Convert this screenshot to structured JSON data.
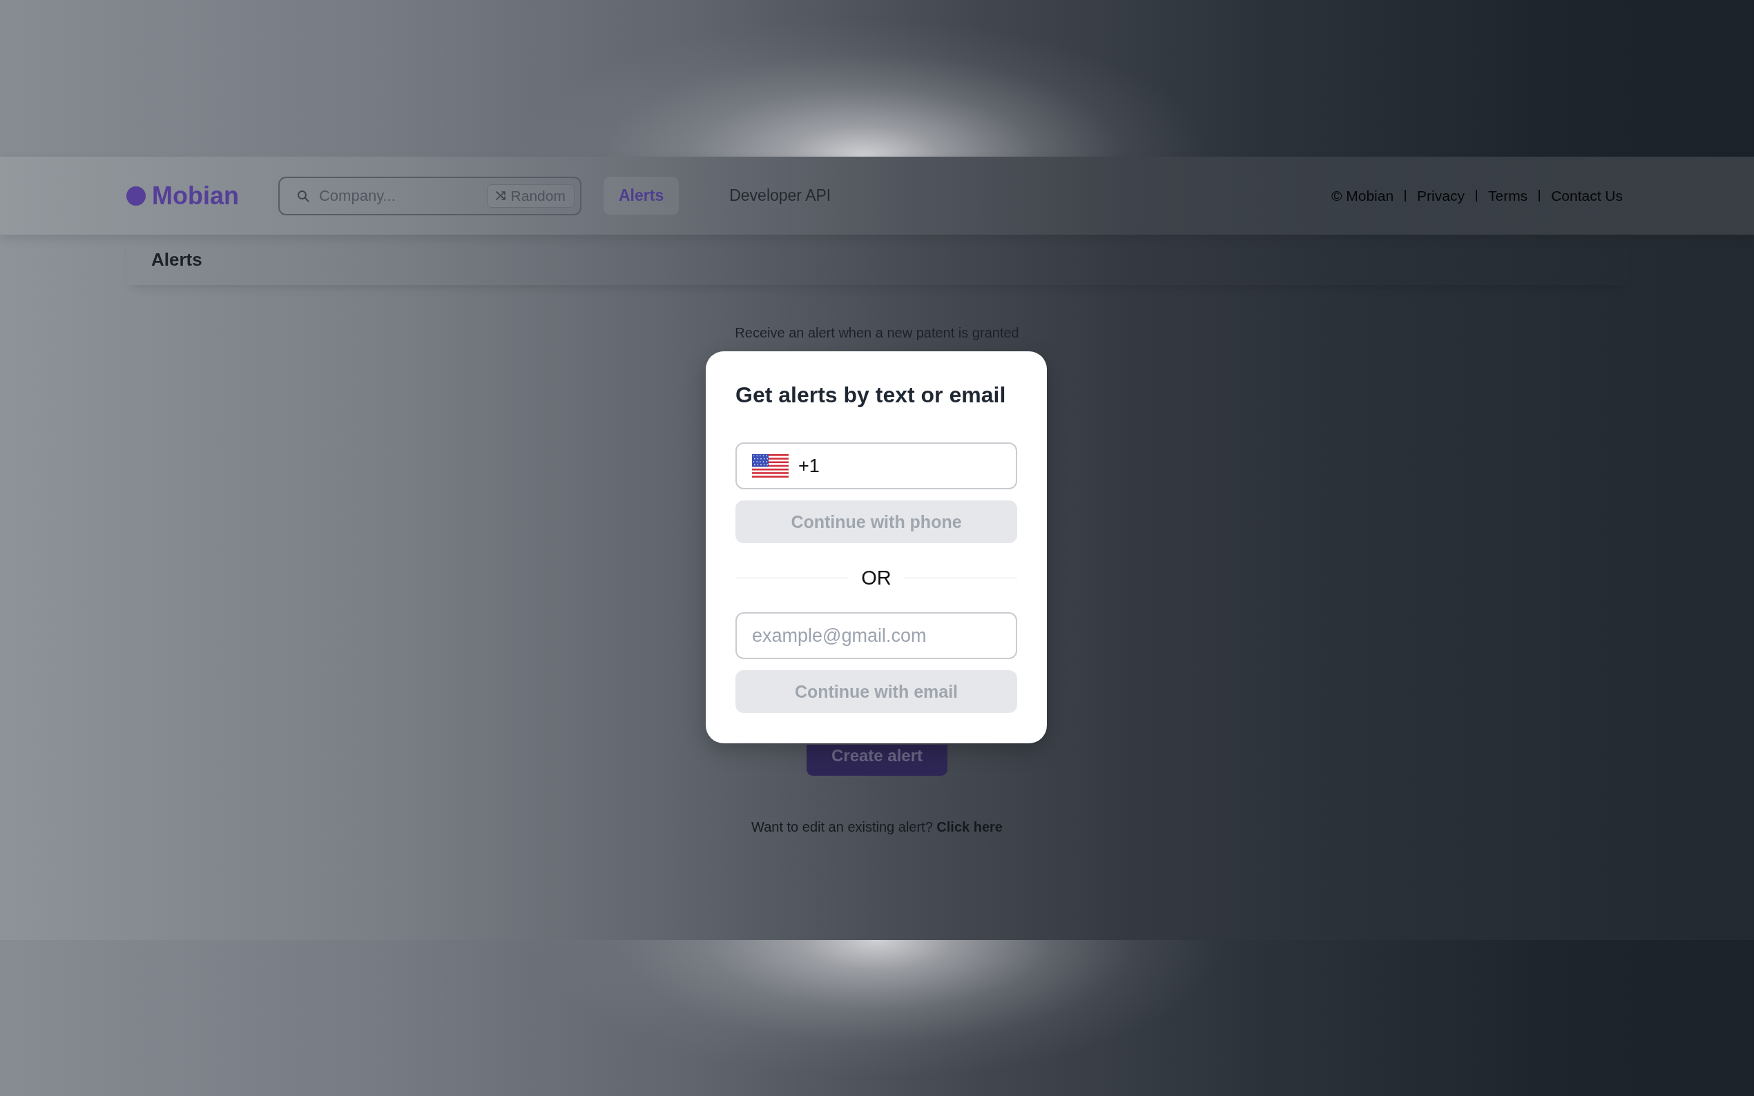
{
  "header": {
    "logo": "Mobian",
    "search": {
      "placeholder": "Company...",
      "random_button": "Random"
    },
    "nav": [
      {
        "label": "Alerts",
        "selected": true
      },
      {
        "label": "Developer API",
        "selected": false
      }
    ],
    "copyright": "© Mobian",
    "links": [
      "Privacy",
      "Terms",
      "Contact Us"
    ]
  },
  "page_title": "Alerts",
  "content": {
    "description": "Receive an alert when a new patent is granted",
    "create_button": "Create alert",
    "edit_prompt": {
      "text": "Want to edit an existing alert?",
      "link": "Click here"
    }
  },
  "modal": {
    "title": "Get alerts by text or email",
    "phone_field": {
      "value": "+1"
    },
    "phone_button": {
      "label": "Continue with phone",
      "disabled": true
    },
    "divider": "OR",
    "email_field": {
      "placeholder": "example@gmail.com"
    },
    "email_button": {
      "label": "Continue with email",
      "disabled": true
    }
  }
}
